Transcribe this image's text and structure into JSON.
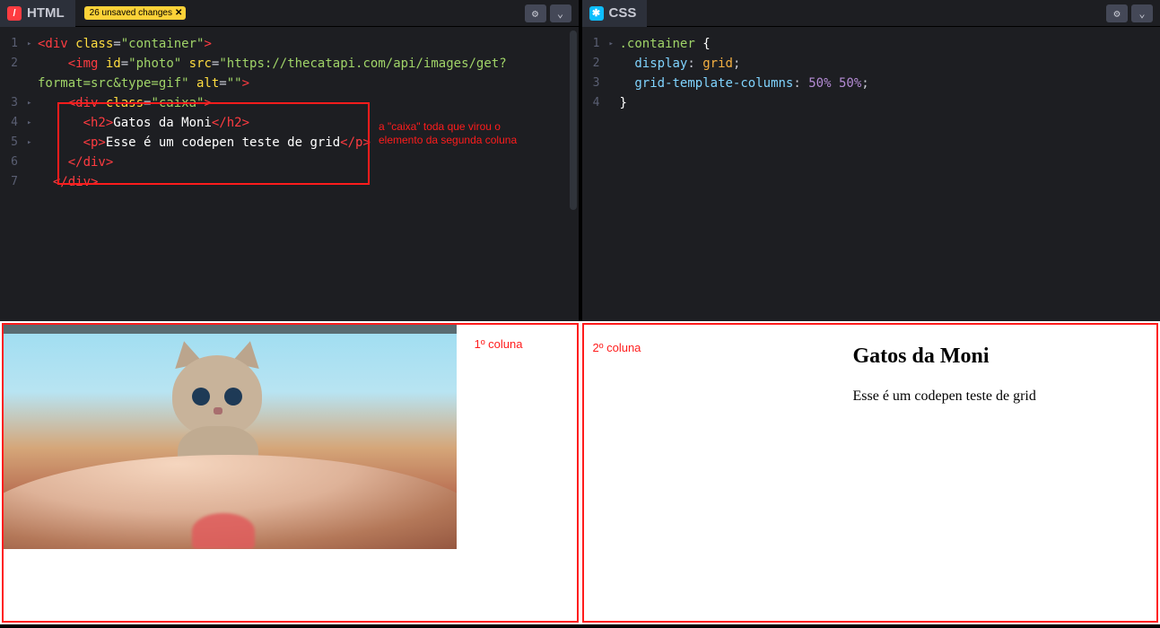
{
  "panels": {
    "html": {
      "title": "HTML",
      "badge": "26 unsaved changes",
      "badge_close": "✕",
      "code": {
        "l1": {
          "t1": "<div",
          "a1": " class",
          "eq1": "=",
          "s1": "\"container\"",
          "t2": ">"
        },
        "l2": {
          "ind": "    ",
          "t1": "<img",
          "a1": " id",
          "eq1": "=",
          "s1": "\"photo\"",
          "a2": " src",
          "eq2": "=",
          "s2": "\"https://thecatapi.com/api/images/get?"
        },
        "l2b": {
          "cont": "format=src&type=gif\"",
          "a3": " alt",
          "eq3": "=",
          "s3": "\"\"",
          "t2": ">"
        },
        "l3": {
          "ind": "    ",
          "t1": "<div",
          "a1": " class",
          "eq1": "=",
          "s1": "\"caixa\"",
          "t2": ">"
        },
        "l4": {
          "ind": "      ",
          "t1": "<h2>",
          "txt": "Gatos da Moni",
          "t2": "</h2>"
        },
        "l5": {
          "ind": "      ",
          "t1": "<p>",
          "txt": "Esse é um codepen teste de grid",
          "t2": "</p>"
        },
        "l6": {
          "ind": "    ",
          "t1": "</div>"
        },
        "l7": {
          "ind": "  ",
          "t1": "</div>"
        }
      },
      "annotation": "a \"caixa\" toda que virou o elemento da segunda coluna"
    },
    "css": {
      "title": "CSS",
      "code": {
        "l1": {
          "sel": ".container ",
          "brace": "{"
        },
        "l2": {
          "ind": "  ",
          "prop": "display",
          "colon": ": ",
          "val": "grid",
          "semi": ";"
        },
        "l3": {
          "ind": "  ",
          "prop": "grid-template-columns",
          "colon": ": ",
          "num1": "50%",
          "sp": " ",
          "num2": "50%",
          "semi": ";"
        },
        "l4": {
          "brace": "}"
        }
      }
    }
  },
  "preview": {
    "col1_label": "1º coluna",
    "col2_label": "2º coluna",
    "heading": "Gatos da Moni",
    "paragraph": "Esse é um codepen teste de grid"
  },
  "icons": {
    "gear": "⚙",
    "chevron": "⌄",
    "html_glyph": "/",
    "css_glyph": "✱"
  }
}
